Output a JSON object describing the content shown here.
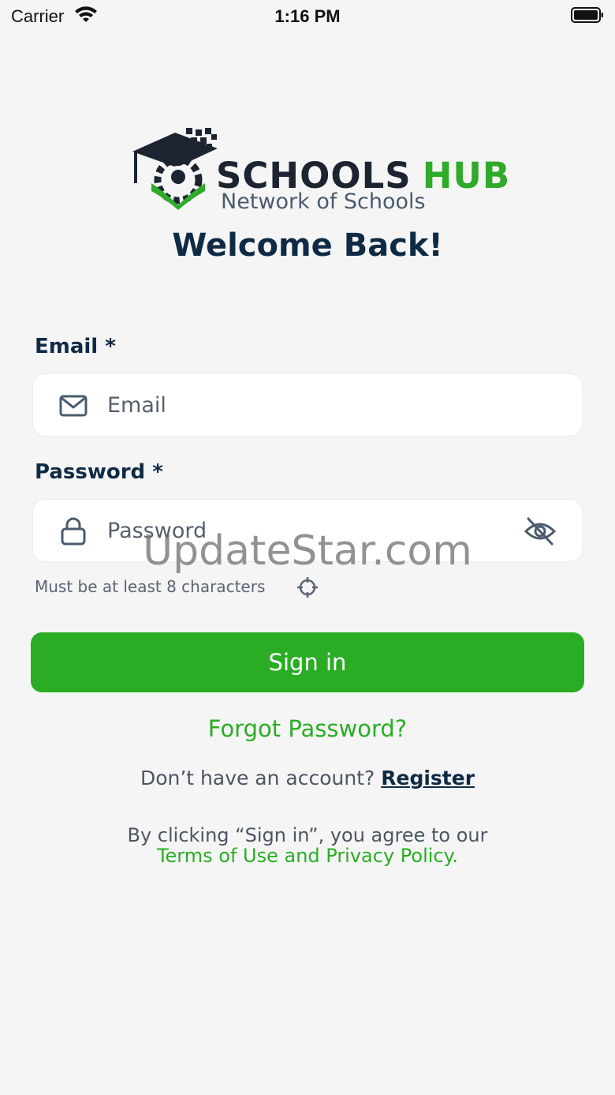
{
  "status_bar": {
    "carrier": "Carrier",
    "time": "1:16 PM"
  },
  "logo": {
    "brand_part1": "SCHOOLS",
    "brand_part2": "HUB",
    "tagline": "Network of Schools",
    "colors": {
      "dark": "#1b2430",
      "green": "#2faa2a",
      "gray": "#4b5b6e"
    }
  },
  "welcome_title": "Welcome Back!",
  "form": {
    "email": {
      "label": "Email *",
      "placeholder": "Email",
      "value": "",
      "icon": "mail-icon"
    },
    "password": {
      "label": "Password *",
      "placeholder": "Password",
      "value": "",
      "icon": "lock-icon",
      "toggle_icon": "eye-off-icon"
    },
    "hint": "Must be at least 8 characters",
    "hint_icon": "crosshair-icon"
  },
  "actions": {
    "sign_in": "Sign in",
    "forgot_password": "Forgot Password?",
    "no_account": "Don’t have an account?",
    "register": "Register"
  },
  "legal": {
    "line1": "By clicking “Sign in”, you agree to our",
    "line2": "Terms of Use and Privacy Policy."
  },
  "watermark": "UpdateStar.com",
  "colors": {
    "accent": "#2aad24",
    "text_dark": "#0f2a44",
    "background": "#f5f5f5"
  }
}
